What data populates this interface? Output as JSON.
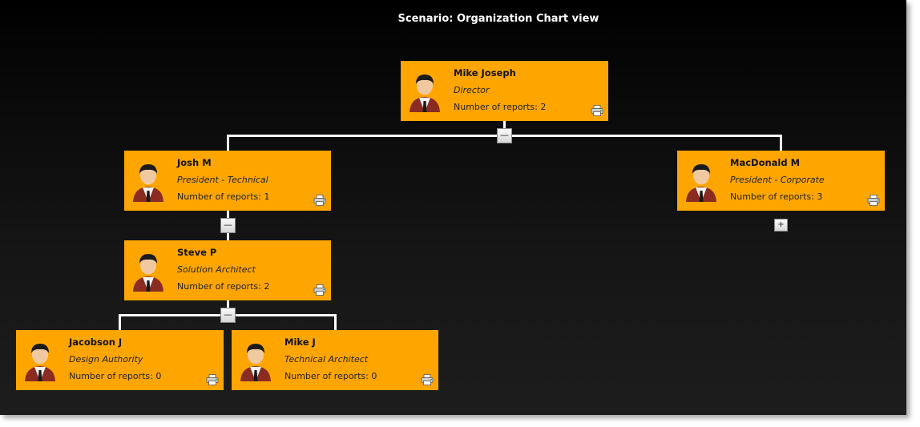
{
  "title": "Scenario: Organization Chart view",
  "nodes": [
    {
      "name": "Mike Joseph",
      "role": "Director",
      "reports": "Number of reports: 2"
    },
    {
      "name": "Josh M",
      "role": "President - Technical",
      "reports": "Number of reports: 1"
    },
    {
      "name": "MacDonald M",
      "role": "President - Corporate",
      "reports": "Number of reports: 3"
    },
    {
      "name": "Steve P",
      "role": "Solution Architect",
      "reports": "Number of reports: 2"
    },
    {
      "name": "Jacobson J",
      "role": "Design Authority",
      "reports": "Number of reports: 0"
    },
    {
      "name": "Mike J",
      "role": "Technical Architect",
      "reports": "Number of reports: 0"
    }
  ],
  "toggles": {
    "collapse_label": "—",
    "expand_label": "+"
  },
  "colors": {
    "card": "#ffa500",
    "connector": "#ffffff",
    "background": "#000000"
  },
  "icons": {
    "avatar": "person-avatar-icon",
    "print": "print-icon"
  }
}
